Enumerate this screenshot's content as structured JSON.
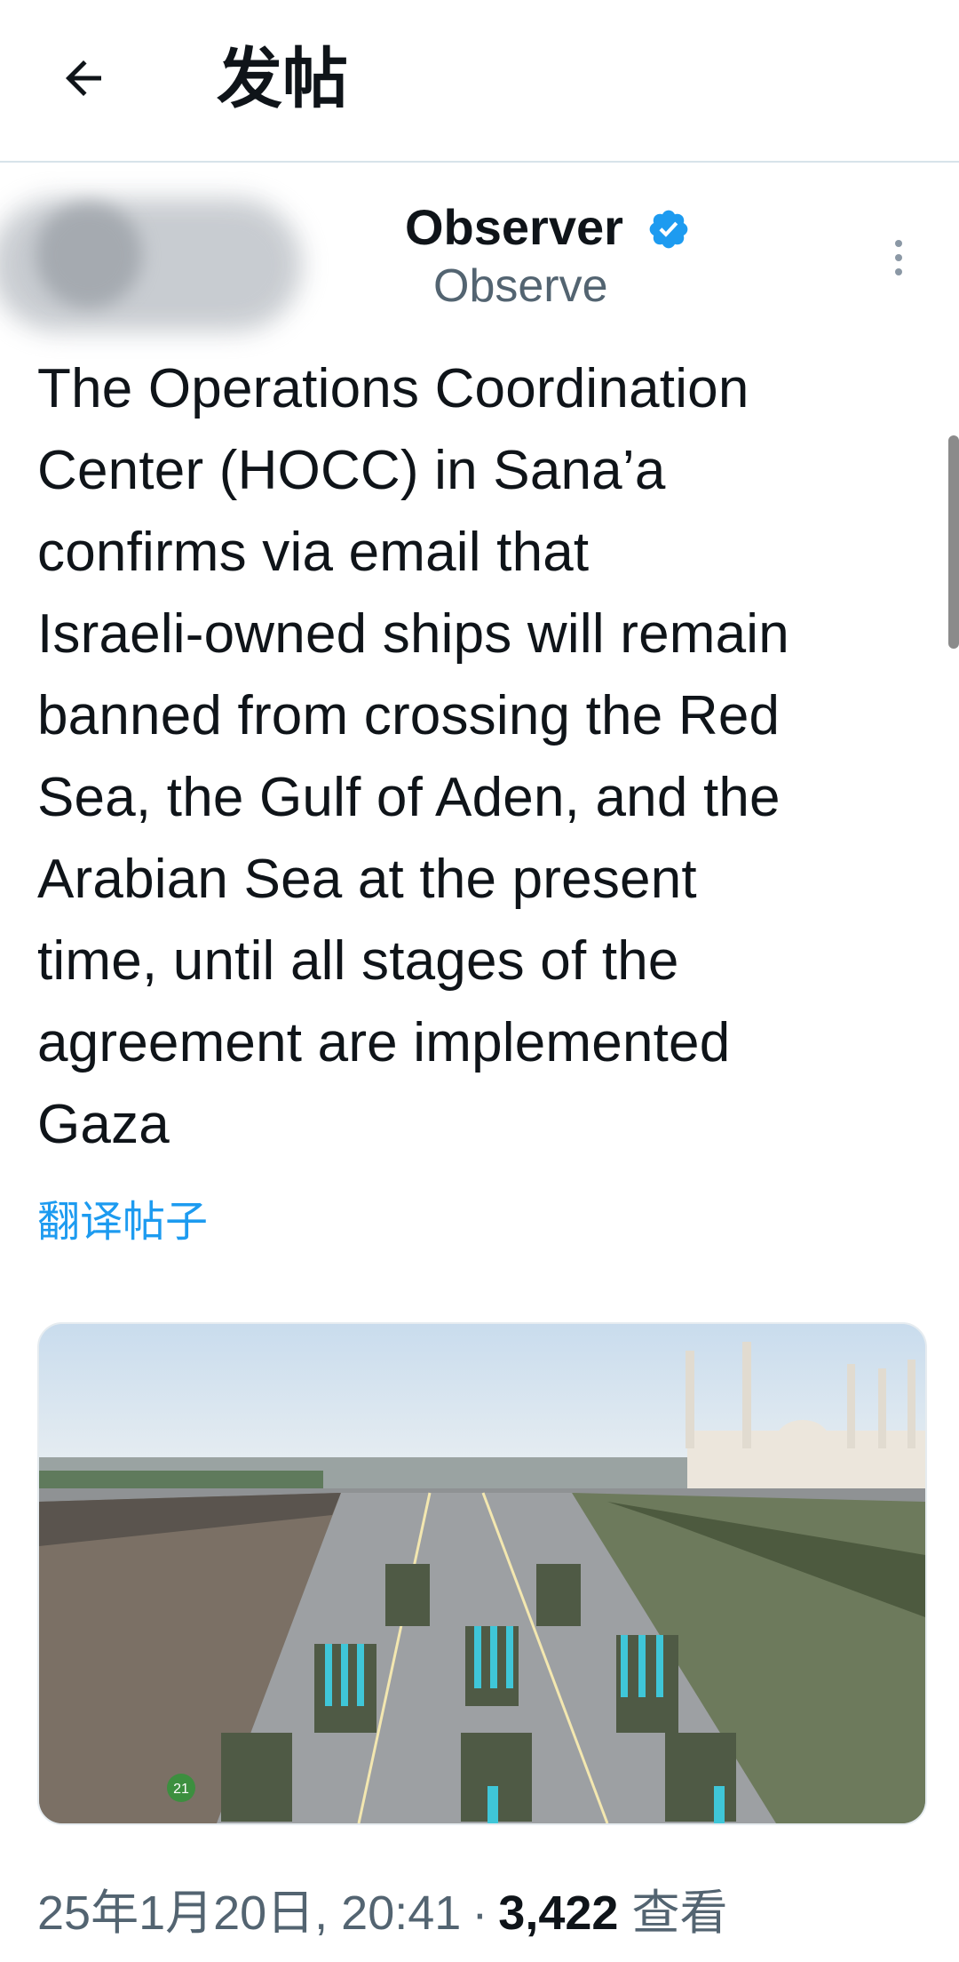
{
  "header": {
    "title": "发帖",
    "back_icon": "arrow-left-icon"
  },
  "author": {
    "display_name": "Observer",
    "handle": "Observe",
    "verified": true,
    "verified_color": "#1d9bf0",
    "more_icon": "more-vertical-icon"
  },
  "post": {
    "text": "The Operations Coordination\nCenter (HOCC) in Sana’a\nconfirms via email that\nIsraeli-owned ships will remain\nbanned from crossing the Red\nSea, the Gulf of Aden, and the\nArabian Sea at the present\ntime, until all stages of the\nagreement are implemented\nGaza",
    "translate_label": "翻译帖子"
  },
  "media": {
    "watermark": "21"
  },
  "meta": {
    "timestamp": "25年1月20日, 20:41",
    "separator": "·",
    "views_count": "3,422",
    "views_label": "查看"
  },
  "colors": {
    "accent": "#1d9bf0",
    "text": "#0f1419",
    "secondary": "#536471"
  }
}
